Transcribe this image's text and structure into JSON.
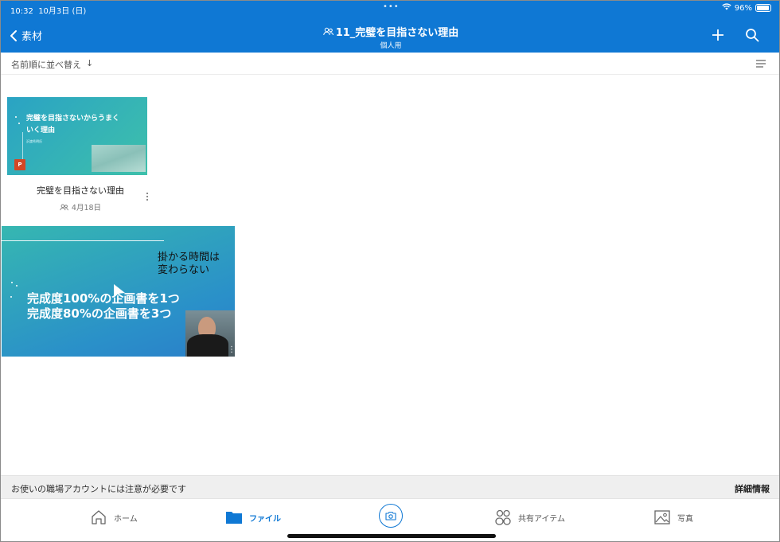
{
  "status": {
    "time": "10:32",
    "date": "10月3日 (日)",
    "dots": "•••",
    "battery": "96%"
  },
  "header": {
    "back_label": "素材",
    "title": "11_完璧を目指さない理由",
    "subtitle": "個人用"
  },
  "sort": {
    "label": "名前順に並べ替え",
    "arrow": "↓"
  },
  "file": {
    "thumb_title": "完璧を目指さないからうまくいく理由",
    "thumb_sub": "沢渡秀明氏",
    "ppt_label": "P",
    "name": "完璧を目指さない理由",
    "date": "4月18日"
  },
  "video": {
    "note_line1": "掛かる時間は",
    "note_line2": "変わらない",
    "head_line1": "完成度100%の企画書を1つ",
    "head_line2": "完成度80%の企画書を3つ",
    "more": "⋮"
  },
  "banner": {
    "text": "お使いの職場アカウントには注意が必要です",
    "link": "詳細情報"
  },
  "tabs": [
    {
      "label": "ホーム",
      "icon": "home-icon"
    },
    {
      "label": "ファイル",
      "icon": "folder-icon"
    },
    {
      "label": "共有アイテム",
      "icon": "people-icon"
    },
    {
      "label": "写真",
      "icon": "photo-icon"
    }
  ],
  "colors": {
    "accent": "#0f78d4",
    "ppt": "#d24726"
  }
}
